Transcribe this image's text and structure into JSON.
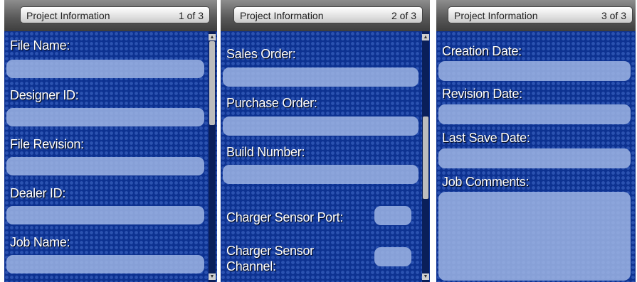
{
  "panels": [
    {
      "header": {
        "title": "Project Information",
        "page": "1 of 3"
      },
      "fields": [
        {
          "label": "File Name:"
        },
        {
          "label": "Designer ID:"
        },
        {
          "label": "File Revision:"
        },
        {
          "label": "Dealer ID:"
        },
        {
          "label": "Job Name:"
        }
      ]
    },
    {
      "header": {
        "title": "Project Information",
        "page": "2 of 3"
      },
      "fields": [
        {
          "label": "Sales Order:"
        },
        {
          "label": "Purchase Order:"
        },
        {
          "label": "Build Number:"
        },
        {
          "label": "Charger Sensor Port:"
        },
        {
          "label": "Charger Sensor Channel:"
        }
      ]
    },
    {
      "header": {
        "title": "Project Information",
        "page": "3 of 3"
      },
      "fields": [
        {
          "label": "Creation Date:"
        },
        {
          "label": "Revision Date:"
        },
        {
          "label": "Last Save Date:"
        },
        {
          "label": "Job Comments:"
        }
      ]
    }
  ],
  "icons": {
    "scroll_up": "arrow-up-icon",
    "scroll_down": "arrow-down-icon"
  }
}
